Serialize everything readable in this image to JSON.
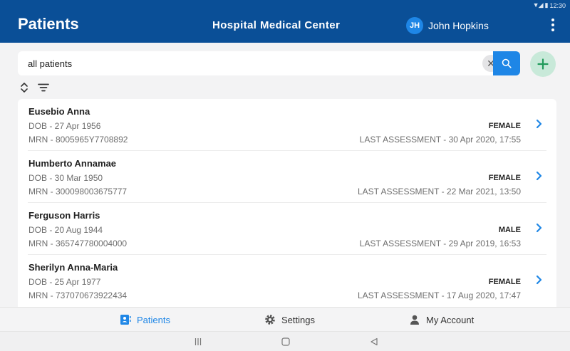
{
  "status_bar": {
    "time": "12:30"
  },
  "header": {
    "title": "Patients",
    "hospital": "Hospital Medical Center",
    "user_initials": "JH",
    "user_name": "John Hopkins"
  },
  "search": {
    "value": "all patients",
    "placeholder": ""
  },
  "patients": [
    {
      "name": "Eusebio Anna",
      "dob": "DOB - 27 Apr 1956",
      "mrn": "MRN - 8005965Y7708892",
      "gender": "FEMALE",
      "last_assessment": "LAST ASSESSMENT - 30 Apr 2020, 17:55"
    },
    {
      "name": "Humberto Annamae",
      "dob": "DOB - 30 Mar 1950",
      "mrn": "MRN - 300098003675777",
      "gender": "FEMALE",
      "last_assessment": "LAST ASSESSMENT - 22 Mar 2021, 13:50"
    },
    {
      "name": "Ferguson Harris",
      "dob": "DOB - 20 Aug 1944",
      "mrn": "MRN - 365747780004000",
      "gender": "MALE",
      "last_assessment": "LAST ASSESSMENT - 29 Apr 2019, 16:53"
    },
    {
      "name": "Sherilyn Anna-Maria",
      "dob": "DOB - 25 Apr 1977",
      "mrn": "MRN - 737070673922434",
      "gender": "FEMALE",
      "last_assessment": "LAST ASSESSMENT - 17 Aug 2020, 17:47"
    }
  ],
  "nav": {
    "patients": "Patients",
    "settings": "Settings",
    "account": "My Account"
  },
  "colors": {
    "brand": "#0a4f97",
    "accent": "#1e86e6",
    "add_button": "#c8e9d9"
  }
}
